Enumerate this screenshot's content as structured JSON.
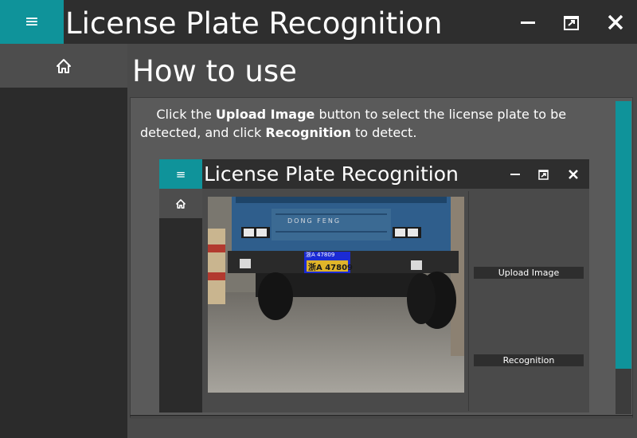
{
  "window": {
    "title": "License Plate Recognition"
  },
  "page": {
    "heading": "How to use"
  },
  "instructions": {
    "part1": "Click the ",
    "bold1": "Upload Image",
    "part2": " button to select the license plate to be detected, and click ",
    "bold2": "Recognition",
    "part3": " to detect."
  },
  "inner_app": {
    "title": "License Plate Recognition",
    "upload_label": "Upload Image",
    "recognition_label": "Recognition",
    "truck_brand": "DONG FENG",
    "plate_detected_text": "浙A 47809",
    "plate_text": "浙A 47809"
  },
  "icons": {
    "menu": "hamburger-icon",
    "home": "home-icon",
    "minimize": "minimize-icon",
    "restore": "restore-icon",
    "close": "close-icon"
  },
  "colors": {
    "accent": "#0f939a",
    "titlebar": "#2e2e2e",
    "main_bg": "#4a4a4a",
    "content_bg": "#5a5a5a"
  }
}
